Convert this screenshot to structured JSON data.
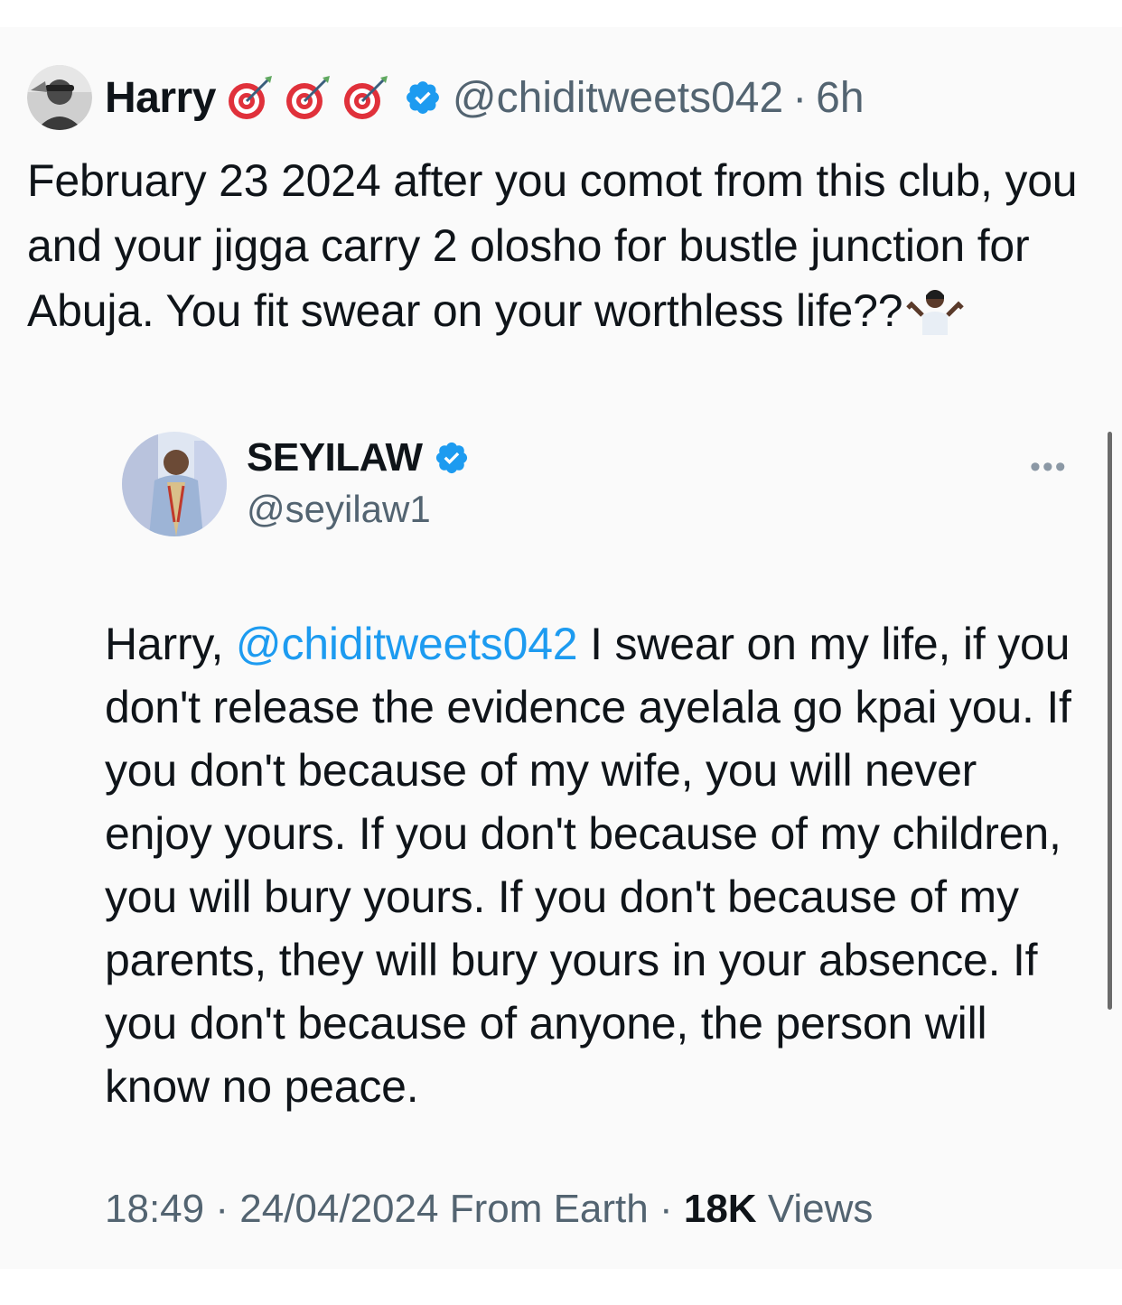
{
  "tweet": {
    "display_name": "Harry",
    "name_emoji": [
      "dart-icon",
      "dart-icon",
      "dart-icon"
    ],
    "handle": "@chiditweets042",
    "separator": "·",
    "time_ago": "6h",
    "text": "February 23 2024 after you comot from this club, you and your jigga carry 2 olosho for bustle junction for Abuja. You fit swear on your worthless life??",
    "trailing_emoji": "person-shrugging-icon"
  },
  "quoted": {
    "display_name": "SEYILAW",
    "handle": "@seyilaw1",
    "more_label": "•••",
    "text_prefix": "Harry, ",
    "mention": "@chiditweets042",
    "text_rest": " I swear on my life, if you don't release the evidence ayelala go kpai you. If you don't because of my wife, you will never enjoy yours. If you don't because of my children, you will bury yours. If you don't because of my parents, they will bury yours in your absence. If you don't because of anyone, the person will know no peace.",
    "time": "18:49",
    "sep1": "·",
    "date": "24/04/2024",
    "source": "From Earth",
    "sep2": "·",
    "views_count": "18K",
    "views_label": "Views"
  },
  "colors": {
    "verified": "#1d9bf0",
    "link": "#1d9bf0",
    "secondary_text": "#536471"
  }
}
